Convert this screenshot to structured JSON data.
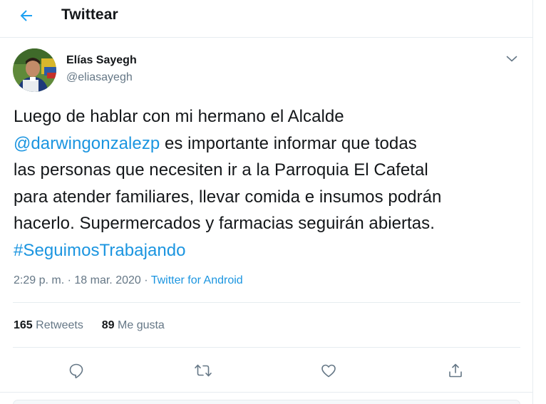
{
  "header": {
    "title": "Twittear",
    "back_icon": "arrow-left-icon"
  },
  "author": {
    "name": "Elías Sayegh",
    "handle": "@eliasayegh",
    "avatar_icon": "avatar-photo"
  },
  "tweet": {
    "lines": [
      {
        "text": "Luego de hablar con mi hermano el Alcalde"
      },
      {
        "mention": "@darwingonzalezp",
        "text": " es importante informar que todas"
      },
      {
        "text": "las personas que necesiten ir a la Parroquia El Cafetal"
      },
      {
        "text": "para atender familiares, llevar comida e insumos podrán"
      },
      {
        "text": "hacerlo. Supermercados y farmacias seguirán abiertas."
      },
      {
        "hashtag": "#SeguimosTrabajando"
      }
    ]
  },
  "meta": {
    "time": "2:29 p. m.",
    "separator": "·",
    "date": "18 mar. 2020",
    "source": "Twitter for Android"
  },
  "stats": {
    "retweets_count": "165",
    "retweets_label": "Retweets",
    "likes_count": "89",
    "likes_label": "Me gusta"
  },
  "actions": {
    "reply_icon": "reply-icon",
    "retweet_icon": "retweet-icon",
    "like_icon": "heart-icon",
    "share_icon": "share-icon"
  },
  "colors": {
    "accent": "#1b95e0",
    "text_primary": "#14171a",
    "text_secondary": "#657786",
    "border": "#e6ecf0"
  }
}
